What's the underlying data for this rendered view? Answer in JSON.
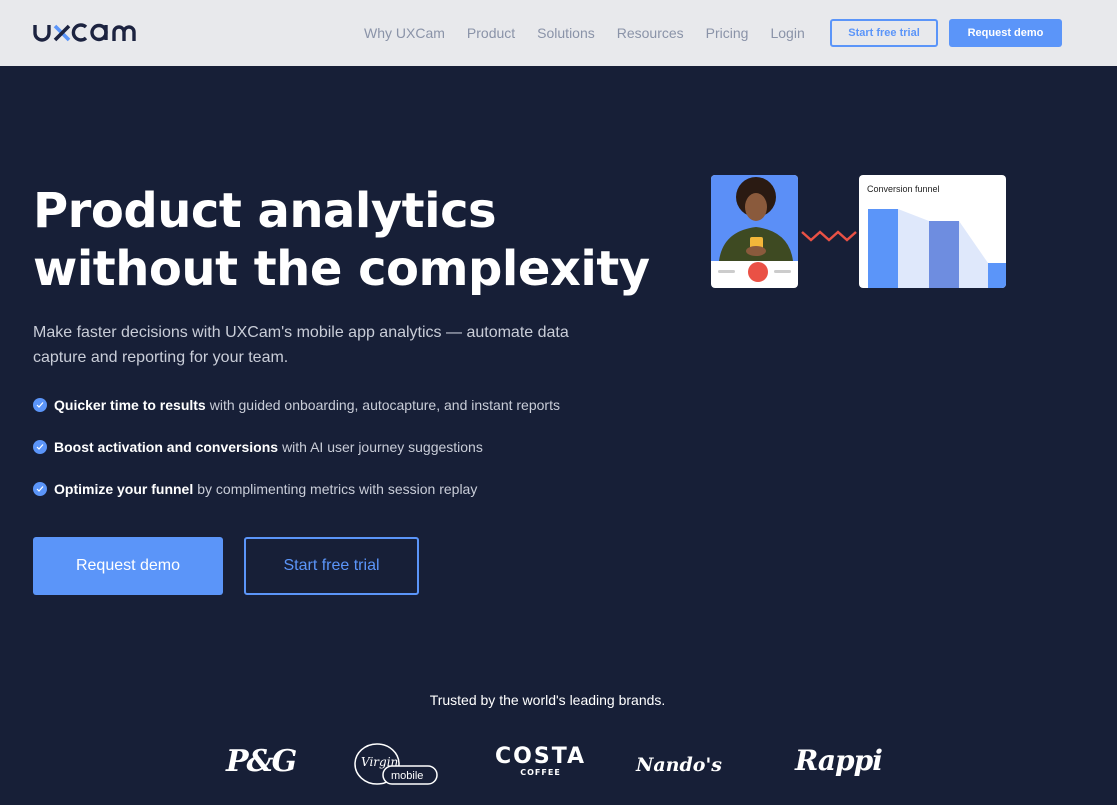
{
  "header": {
    "logo_text": "uxcam",
    "nav": [
      "Why UXCam",
      "Product",
      "Solutions",
      "Resources",
      "Pricing",
      "Login"
    ],
    "trial_label": "Start free trial",
    "demo_label": "Request demo"
  },
  "hero": {
    "title_line1": "Product analytics",
    "title_line2": "without the complexity",
    "subtitle": "Make faster decisions with UXCam's mobile app analytics — automate data capture and reporting for your team.",
    "bullets": [
      {
        "bold": "Quicker time to results",
        "rest": "with guided onboarding, autocapture, and instant reports"
      },
      {
        "bold": "Boost activation and conversions",
        "rest": "with AI user journey suggestions"
      },
      {
        "bold": "Optimize your funnel",
        "rest": "by complimenting metrics with session replay"
      }
    ],
    "demo_button": "Request demo",
    "trial_button": "Start free trial"
  },
  "illustration": {
    "funnel_title": "Conversion funnel",
    "colors": {
      "primary": "#5b95f9",
      "secondary": "#6e8de0",
      "fill": "#dfe8fb",
      "record": "#ea5145"
    }
  },
  "trusted": {
    "heading": "Trusted by the world's leading brands.",
    "brands": [
      "P&G",
      "Virgin mobile",
      "COSTA COFFEE",
      "Nando's",
      "Rappi"
    ]
  },
  "colors": {
    "accent": "#5b95f9",
    "background": "#171f37",
    "header_bg": "#e8e9ec"
  }
}
